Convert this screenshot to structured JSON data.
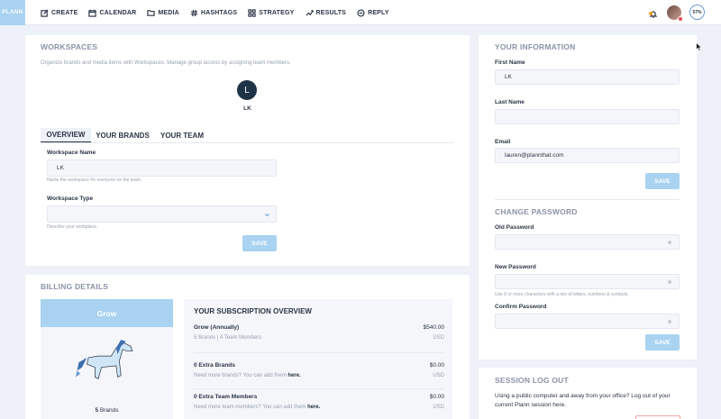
{
  "brand": {
    "logo_text": "PLANN"
  },
  "nav": [
    {
      "icon": "edit-icon",
      "label": "CREATE"
    },
    {
      "icon": "calendar-icon",
      "label": "CALENDAR"
    },
    {
      "icon": "folder-icon",
      "label": "MEDIA"
    },
    {
      "icon": "hashtag-icon",
      "label": "HASHTAGS"
    },
    {
      "icon": "grid-icon",
      "label": "STRATEGY"
    },
    {
      "icon": "trend-icon",
      "label": "RESULTS"
    },
    {
      "icon": "chat-icon",
      "label": "REPLY"
    }
  ],
  "header": {
    "progress": "57%"
  },
  "workspaces": {
    "title": "WORKSPACES",
    "description": "Organize brands and media items with Workspaces. Manage group access by assigning team members.",
    "avatar_letter": "L",
    "avatar_name": "LK",
    "tabs": [
      "OVERVIEW",
      "YOUR BRANDS",
      "YOUR TEAM"
    ],
    "name_label": "Workspace Name",
    "name_value": "LK",
    "name_help": "Name the workspace for everyone on the team.",
    "type_label": "Workspace Type",
    "type_value": "",
    "type_help": "Describe your workplace.",
    "save": "SAVE"
  },
  "billing": {
    "title": "BILLING DETAILS",
    "plan_name": "Grow",
    "plan_brands_count": "5",
    "plan_brands_label": "Brands",
    "overview_title": "YOUR SUBSCRIPTION OVERVIEW",
    "rows": [
      {
        "title": "Grow (Annually)",
        "amount": "$540.00",
        "sub": "5 Brands | 4 Team Members",
        "currency": "USD",
        "link": ""
      },
      {
        "title": "0 Extra Brands",
        "amount": "$0.00",
        "sub": "Need more brands? You can add them ",
        "currency": "USD",
        "link": "here."
      },
      {
        "title": "0 Extra Team Members",
        "amount": "$0.00",
        "sub": "Need more team members? You can add them ",
        "currency": "USD",
        "link": "here."
      }
    ]
  },
  "info": {
    "title": "YOUR INFORMATION",
    "first_label": "First Name",
    "first_value": "LK",
    "last_label": "Last Name",
    "last_value": "",
    "email_label": "Email",
    "email_value": "lauren@plannthat.com",
    "save": "SAVE"
  },
  "password": {
    "title": "CHANGE PASSWORD",
    "old_label": "Old Password",
    "new_label": "New Password",
    "new_help": "Use 8 or more characters with a mix of letters, numbers & symbols.",
    "confirm_label": "Confirm Password",
    "save": "SAVE"
  },
  "session": {
    "title": "SESSION LOG OUT",
    "text": "Using a public computer and away from your office? Log out of your current Plann session here."
  },
  "colors": {
    "accent": "#a9d3f1",
    "dark": "#1f3347",
    "bg": "#eef1f8"
  }
}
